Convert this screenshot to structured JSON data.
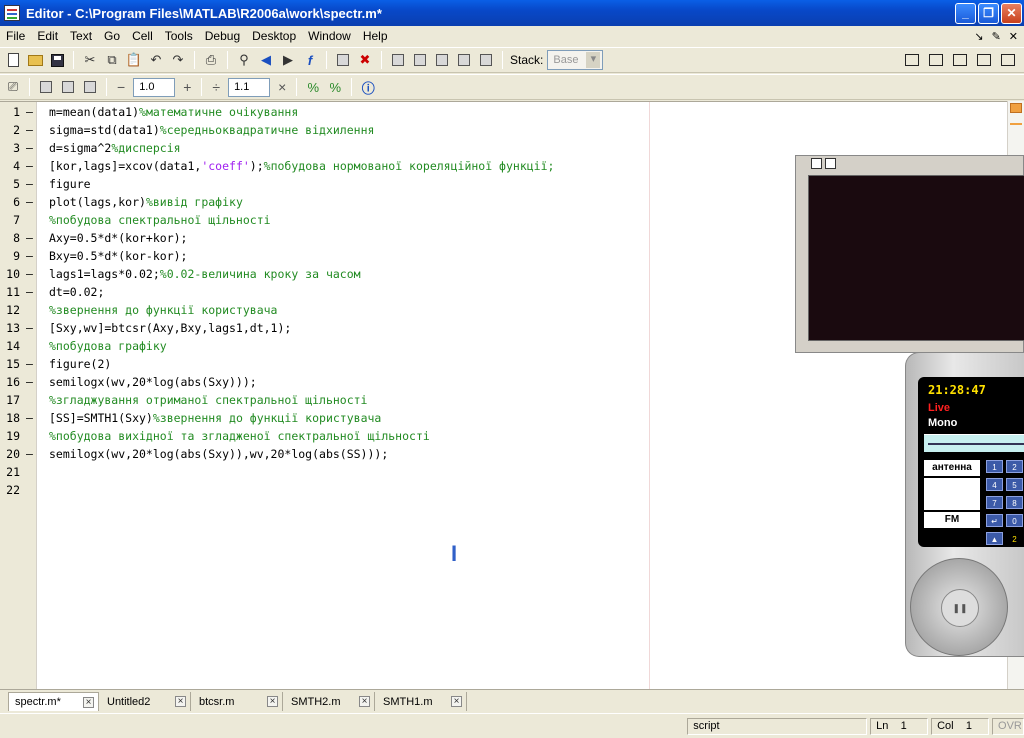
{
  "window": {
    "title": "Editor - C:\\Program Files\\MATLAB\\R2006a\\work\\spectr.m*",
    "min_glyph": "_",
    "max_glyph": "❐",
    "close_glyph": "✕"
  },
  "menu": {
    "items": [
      "File",
      "Edit",
      "Text",
      "Go",
      "Cell",
      "Tools",
      "Debug",
      "Desktop",
      "Window",
      "Help"
    ],
    "right_glyphs": [
      "↘",
      "✎",
      "✕"
    ]
  },
  "toolbar": {
    "stack_label": "Stack:",
    "stack_value": "Base"
  },
  "celltoolbar": {
    "minus": "−",
    "value1": "1.0",
    "plus": "+",
    "divide": "÷",
    "value2": "1.1",
    "times": "×"
  },
  "editor": {
    "lines": [
      {
        "n": "1",
        "dash": "–",
        "segs": [
          {
            "t": "m=mean(data1)",
            "c": "code"
          },
          {
            "t": "%математичне очікування",
            "c": "cmt"
          }
        ]
      },
      {
        "n": "2",
        "dash": "–",
        "segs": [
          {
            "t": "sigma=std(data1)",
            "c": "code"
          },
          {
            "t": "%середньоквадратичне відхилення",
            "c": "cmt"
          }
        ]
      },
      {
        "n": "3",
        "dash": "–",
        "segs": [
          {
            "t": "d=sigma^2",
            "c": "code"
          },
          {
            "t": "%дисперсія",
            "c": "cmt"
          }
        ]
      },
      {
        "n": "4",
        "dash": "–",
        "segs": [
          {
            "t": "[kor,lags]=xcov(data1,",
            "c": "code"
          },
          {
            "t": "'coeff'",
            "c": "str"
          },
          {
            "t": ");",
            "c": "code"
          },
          {
            "t": "%побудова нормованої кореляційної функції;",
            "c": "cmt"
          }
        ]
      },
      {
        "n": "5",
        "dash": "–",
        "segs": [
          {
            "t": "figure",
            "c": "code"
          }
        ]
      },
      {
        "n": "6",
        "dash": "–",
        "segs": [
          {
            "t": "plot(lags,kor)",
            "c": "code"
          },
          {
            "t": "%вивід графіку",
            "c": "cmt"
          }
        ]
      },
      {
        "n": "7",
        "dash": "",
        "segs": [
          {
            "t": "%побудова спектральної щільності",
            "c": "cmt"
          }
        ]
      },
      {
        "n": "8",
        "dash": "–",
        "segs": [
          {
            "t": "Axy=0.5*d*(kor+kor);",
            "c": "code"
          }
        ]
      },
      {
        "n": "9",
        "dash": "–",
        "segs": [
          {
            "t": "Bxy=0.5*d*(kor-kor);",
            "c": "code"
          }
        ]
      },
      {
        "n": "10",
        "dash": "–",
        "segs": [
          {
            "t": "lags1=lags*0.02;",
            "c": "code"
          },
          {
            "t": "%0.02-величина кроку за часом",
            "c": "cmt"
          }
        ]
      },
      {
        "n": "11",
        "dash": "–",
        "segs": [
          {
            "t": "dt=0.02;",
            "c": "code"
          }
        ]
      },
      {
        "n": "12",
        "dash": "",
        "segs": [
          {
            "t": "%звернення до функції користувача",
            "c": "cmt"
          }
        ]
      },
      {
        "n": "13",
        "dash": "–",
        "segs": [
          {
            "t": "[Sxy,wv]=btcsr(Axy,Bxy,lags1,dt,1);",
            "c": "code"
          }
        ]
      },
      {
        "n": "14",
        "dash": "",
        "segs": [
          {
            "t": "%побудова графіку",
            "c": "cmt"
          }
        ]
      },
      {
        "n": "15",
        "dash": "–",
        "segs": [
          {
            "t": "figure(2)",
            "c": "code"
          }
        ]
      },
      {
        "n": "16",
        "dash": "–",
        "segs": [
          {
            "t": "semilogx(wv,20*log(abs(Sxy)));",
            "c": "code"
          }
        ]
      },
      {
        "n": "17",
        "dash": "",
        "segs": [
          {
            "t": "%згладжування отриманої спектральної щільності",
            "c": "cmt"
          }
        ]
      },
      {
        "n": "18",
        "dash": "–",
        "segs": [
          {
            "t": "[SS]=SMTH1(Sxy)",
            "c": "code"
          },
          {
            "t": "%звернення до функції користувача",
            "c": "cmt"
          }
        ]
      },
      {
        "n": "19",
        "dash": "",
        "segs": [
          {
            "t": "%побудова вихідної та згладженої спектральної щільності",
            "c": "cmt"
          }
        ]
      },
      {
        "n": "20",
        "dash": "–",
        "segs": [
          {
            "t": "semilogx(wv,20*log(abs(Sxy)),wv,20*log(abs(SS)));",
            "c": "code"
          }
        ]
      },
      {
        "n": "21",
        "dash": "",
        "segs": []
      },
      {
        "n": "22",
        "dash": "",
        "segs": []
      }
    ],
    "cursor_glyph": "I"
  },
  "radio": {
    "time": "21:28:47",
    "live": "Live",
    "mono": "Mono",
    "antenna": "антенна",
    "fm": "FM",
    "keys": [
      "1",
      "2",
      "4",
      "5",
      "7",
      "8",
      "↵",
      "0",
      "▲",
      "2"
    ]
  },
  "tabs": [
    {
      "label": "spectr.m*",
      "active": true
    },
    {
      "label": "Untitled2",
      "active": false
    },
    {
      "label": "btcsr.m",
      "active": false
    },
    {
      "label": "SMTH2.m",
      "active": false
    },
    {
      "label": "SMTH1.m",
      "active": false
    }
  ],
  "status": {
    "mode": "script",
    "ln_label": "Ln",
    "ln": "1",
    "col_label": "Col",
    "col": "1",
    "ovr": "OVR"
  }
}
